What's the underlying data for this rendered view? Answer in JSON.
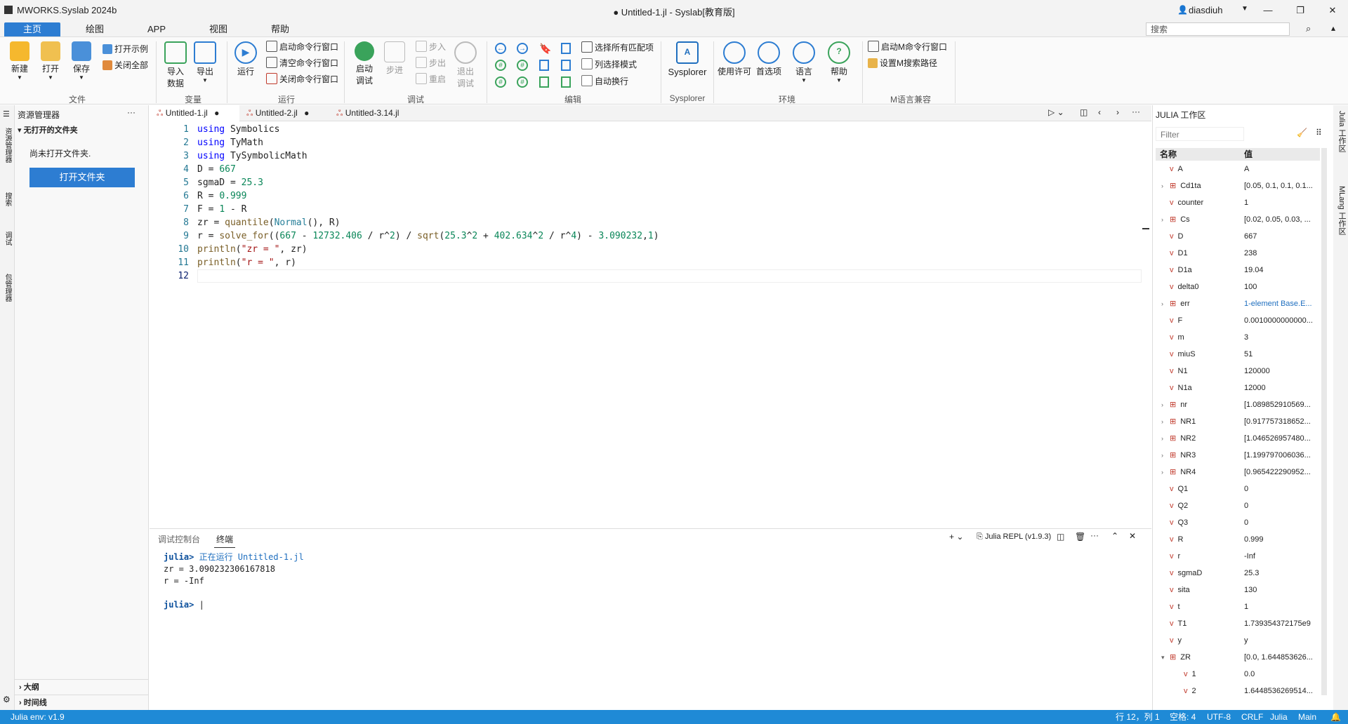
{
  "titlebar": {
    "app": "MWORKS.Syslab 2024b",
    "title": "● Untitled-1.jl - Syslab[教育版]",
    "user": "diasdiuh"
  },
  "tabs": [
    "主页",
    "绘图",
    "APP",
    "视图",
    "帮助"
  ],
  "search_placeholder": "搜索",
  "ribbon": {
    "file": {
      "new": "新建",
      "open": "打开",
      "save": "保存",
      "open_example": "打开示例",
      "close_all": "关闭全部",
      "group": "文件"
    },
    "var": {
      "import": "导入\n数据",
      "export": "导出",
      "group": "变量"
    },
    "run": {
      "run": "运行",
      "start_cmd": "启动命令行窗口",
      "clear_cmd": "清空命令行窗口",
      "close_cmd": "关闭命令行窗口",
      "group": "运行"
    },
    "debug": {
      "start": "启动\n调试",
      "step": "步进",
      "step_in": "步入",
      "step_out": "步出",
      "restart": "重启",
      "exit": "退出\n调试",
      "group": "调试"
    },
    "edit": {
      "select_all": "选择所有匹配项",
      "column_mode": "列选择模式",
      "word_wrap": "自动换行",
      "group": "编辑"
    },
    "sysplorer": {
      "label": "Sysplorer",
      "group": "Sysplorer"
    },
    "env": {
      "license": "使用许可",
      "prefs": "首选项",
      "lang": "语言",
      "help": "帮助",
      "group": "环境"
    },
    "m": {
      "start_m": "启动M命令行窗口",
      "set_m_path": "设置M搜索路径",
      "group": "M语言兼容"
    }
  },
  "activity": [
    "资源管理器",
    "搜索",
    "调试",
    "包管理器"
  ],
  "explorer": {
    "title": "资源管理器",
    "section": "无打开的文件夹",
    "empty": "尚未打开文件夹.",
    "open_btn": "打开文件夹",
    "outline": "大纲",
    "timeline": "时间线"
  },
  "editor_tabs": [
    "Untitled-1.jl",
    "Untitled-2.jl",
    "Untitled-3.14.jl"
  ],
  "panel": {
    "tab1": "调试控制台",
    "tab2": "终端",
    "repl": "Julia REPL (v1.9.3)"
  },
  "terminal": {
    "prompt": "julia>",
    "running": " 正在运行 Untitled-1.jl",
    "out1": "zr = 3.090232306167818",
    "out2": "r = -Inf"
  },
  "workspace": {
    "title": "JULIA 工作区",
    "filter": "Filter",
    "col_name": "名称",
    "col_value": "值",
    "vars": [
      {
        "name": "A",
        "value": "A",
        "arr": false
      },
      {
        "name": "Cd1ta",
        "value": "[0.05, 0.1, 0.1, 0.1...",
        "arr": true
      },
      {
        "name": "counter",
        "value": "1",
        "arr": false
      },
      {
        "name": "Cs",
        "value": "[0.02, 0.05, 0.03, ...",
        "arr": true
      },
      {
        "name": "D",
        "value": "667",
        "arr": false
      },
      {
        "name": "D1",
        "value": "238",
        "arr": false
      },
      {
        "name": "D1a",
        "value": "19.04",
        "arr": false
      },
      {
        "name": "delta0",
        "value": "100",
        "arr": false
      },
      {
        "name": "err",
        "value": "1-element Base.E...",
        "arr": true,
        "link": true
      },
      {
        "name": "F",
        "value": "0.0010000000000...",
        "arr": false
      },
      {
        "name": "m",
        "value": "3",
        "arr": false
      },
      {
        "name": "miuS",
        "value": "51",
        "arr": false
      },
      {
        "name": "N1",
        "value": "120000",
        "arr": false
      },
      {
        "name": "N1a",
        "value": "12000",
        "arr": false
      },
      {
        "name": "nr",
        "value": "[1.089852910569...",
        "arr": true
      },
      {
        "name": "NR1",
        "value": "[0.917757318652...",
        "arr": true
      },
      {
        "name": "NR2",
        "value": "[1.046526957480...",
        "arr": true
      },
      {
        "name": "NR3",
        "value": "[1.199797006036...",
        "arr": true
      },
      {
        "name": "NR4",
        "value": "[0.965422290952...",
        "arr": true
      },
      {
        "name": "Q1",
        "value": "0",
        "arr": false
      },
      {
        "name": "Q2",
        "value": "0",
        "arr": false
      },
      {
        "name": "Q3",
        "value": "0",
        "arr": false
      },
      {
        "name": "R",
        "value": "0.999",
        "arr": false
      },
      {
        "name": "r",
        "value": "-Inf",
        "arr": false
      },
      {
        "name": "sgmaD",
        "value": "25.3",
        "arr": false
      },
      {
        "name": "sita",
        "value": "130",
        "arr": false
      },
      {
        "name": "t",
        "value": "1",
        "arr": false
      },
      {
        "name": "T1",
        "value": "1.739354372175e9",
        "arr": false
      },
      {
        "name": "y",
        "value": "y",
        "arr": false
      },
      {
        "name": "ZR",
        "value": "[0.0, 1.644853626...",
        "arr": true,
        "open": true
      },
      {
        "name": "1",
        "value": "0.0",
        "arr": false,
        "child": true
      },
      {
        "name": "2",
        "value": "1.6448536269514...",
        "arr": false,
        "child": true
      }
    ]
  },
  "side_right": [
    "Julia 工作区",
    "MLang 工作区"
  ],
  "status": {
    "env": "Julia env: v1.9",
    "pos": "行 12，列 1",
    "spaces": "空格: 4",
    "enc": "UTF-8",
    "eol": "CRLF",
    "lang": "Julia",
    "branch": "Main"
  }
}
